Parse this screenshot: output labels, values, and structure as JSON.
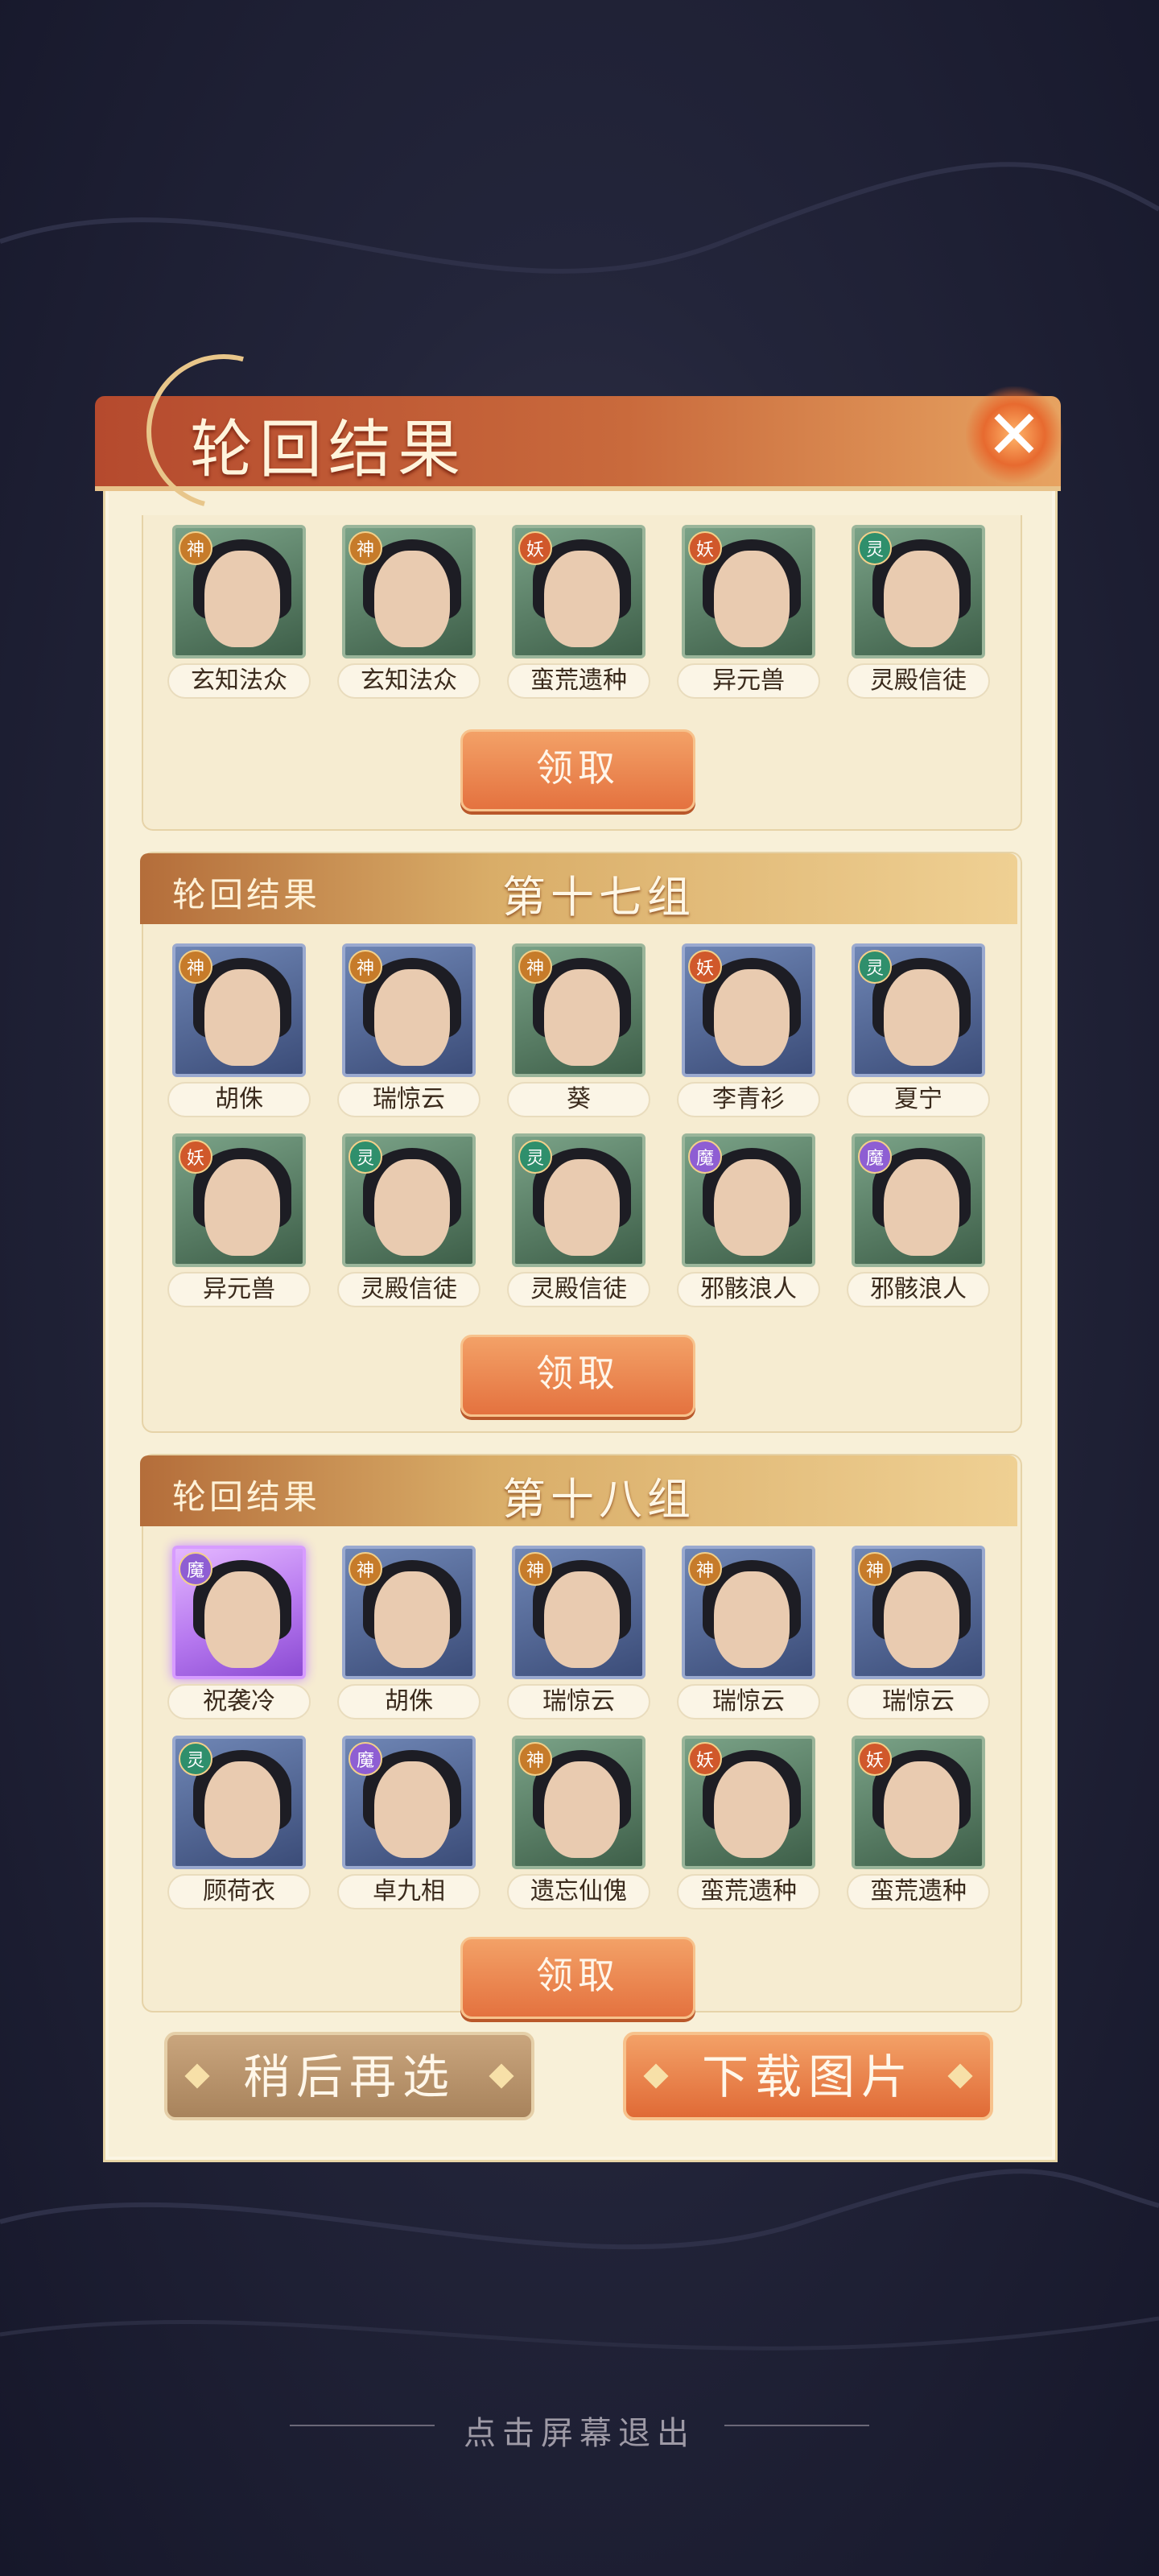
{
  "title": "轮回结果",
  "close_label": "✕",
  "group_partial": {
    "cards": [
      {
        "name": "玄知法众",
        "badge": "神",
        "style": "green"
      },
      {
        "name": "玄知法众",
        "badge": "神",
        "style": "green"
      },
      {
        "name": "蛮荒遗种",
        "badge": "妖",
        "style": "green"
      },
      {
        "name": "异元兽",
        "badge": "妖",
        "style": "green"
      },
      {
        "name": "灵殿信徒",
        "badge": "灵",
        "style": "green"
      }
    ],
    "claim_label": "领取"
  },
  "group_17": {
    "header_label": "轮回结果",
    "number_label": "第十七组",
    "cards": [
      {
        "name": "胡侏",
        "badge": "神",
        "style": "blue"
      },
      {
        "name": "瑞惊云",
        "badge": "神",
        "style": "blue"
      },
      {
        "name": "葵",
        "badge": "神",
        "style": "green"
      },
      {
        "name": "李青衫",
        "badge": "妖",
        "style": "blue"
      },
      {
        "name": "夏宁",
        "badge": "灵",
        "style": "blue"
      },
      {
        "name": "异元兽",
        "badge": "妖",
        "style": "green"
      },
      {
        "name": "灵殿信徒",
        "badge": "灵",
        "style": "green"
      },
      {
        "name": "灵殿信徒",
        "badge": "灵",
        "style": "green"
      },
      {
        "name": "邪骸浪人",
        "badge": "魔",
        "style": "green"
      },
      {
        "name": "邪骸浪人",
        "badge": "魔",
        "style": "green"
      }
    ],
    "claim_label": "领取"
  },
  "group_18": {
    "header_label": "轮回结果",
    "number_label": "第十八组",
    "cards": [
      {
        "name": "祝袭冷",
        "badge": "魔",
        "style": "purple"
      },
      {
        "name": "胡侏",
        "badge": "神",
        "style": "blue"
      },
      {
        "name": "瑞惊云",
        "badge": "神",
        "style": "blue"
      },
      {
        "name": "瑞惊云",
        "badge": "神",
        "style": "blue"
      },
      {
        "name": "瑞惊云",
        "badge": "神",
        "style": "blue"
      },
      {
        "name": "顾荷衣",
        "badge": "灵",
        "style": "blue"
      },
      {
        "name": "卓九相",
        "badge": "魔",
        "style": "blue"
      },
      {
        "name": "遗忘仙傀",
        "badge": "神",
        "style": "green"
      },
      {
        "name": "蛮荒遗种",
        "badge": "妖",
        "style": "green"
      },
      {
        "name": "蛮荒遗种",
        "badge": "妖",
        "style": "green"
      }
    ],
    "claim_label": "领取"
  },
  "buttons": {
    "later_label": "稍后再选",
    "download_label": "下载图片"
  },
  "exit_hint": "点击屏幕退出",
  "colors": {
    "accent": "#e4723f",
    "panel": "#f8f0d8",
    "title_bar": "#b54a2e"
  }
}
